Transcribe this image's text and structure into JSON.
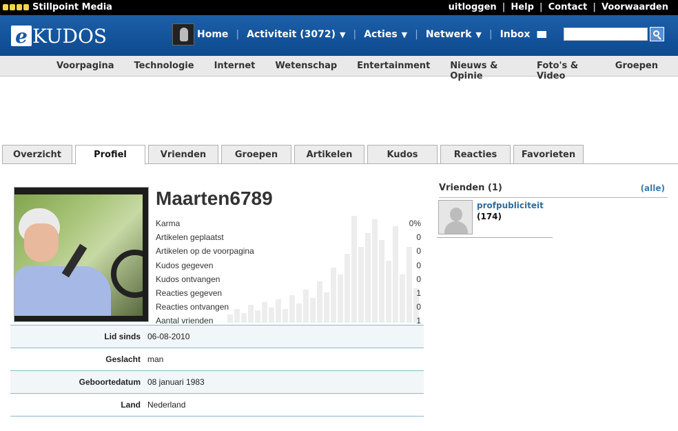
{
  "topbar": {
    "brand": "Stillpoint Media",
    "links": [
      "uitloggen",
      "Help",
      "Contact",
      "Voorwaarden"
    ]
  },
  "header": {
    "logo_letter": "e",
    "logo_word": "KUDOS",
    "nav": {
      "home": "Home",
      "activity": "Activiteit (3072)",
      "actions": "Acties",
      "network": "Netwerk",
      "inbox": "Inbox"
    },
    "search": {
      "placeholder": ""
    }
  },
  "categories": [
    "Voorpagina",
    "Technologie",
    "Internet",
    "Wetenschap",
    "Entertainment",
    "Nieuws & Opinie",
    "Foto's & Video",
    "Groepen"
  ],
  "tabs": [
    "Overzicht",
    "Profiel",
    "Vrienden",
    "Groepen",
    "Artikelen",
    "Kudos",
    "Reacties",
    "Favorieten"
  ],
  "active_tab": "Profiel",
  "profile": {
    "username": "Maarten6789",
    "stats": [
      {
        "label": "Karma",
        "value": "0%"
      },
      {
        "label": "Artikelen geplaatst",
        "value": "0"
      },
      {
        "label": "Artikelen op de voorpagina",
        "value": "0"
      },
      {
        "label": "Kudos gegeven",
        "value": "0"
      },
      {
        "label": "Kudos ontvangen",
        "value": "0"
      },
      {
        "label": "Reacties gegeven",
        "value": "1"
      },
      {
        "label": "Reacties ontvangen",
        "value": "0"
      },
      {
        "label": "Aantal vrienden",
        "value": "1"
      }
    ],
    "details": [
      {
        "label": "Lid sinds",
        "value": "06-08-2010"
      },
      {
        "label": "Geslacht",
        "value": "man"
      },
      {
        "label": "Geboortedatum",
        "value": "08 januari 1983"
      },
      {
        "label": "Land",
        "value": "Nederland"
      }
    ]
  },
  "friends": {
    "title": "Vrienden (1)",
    "all_link": "(alle)",
    "list": [
      {
        "name": "profpubliciteit",
        "count": "(174)"
      }
    ]
  }
}
